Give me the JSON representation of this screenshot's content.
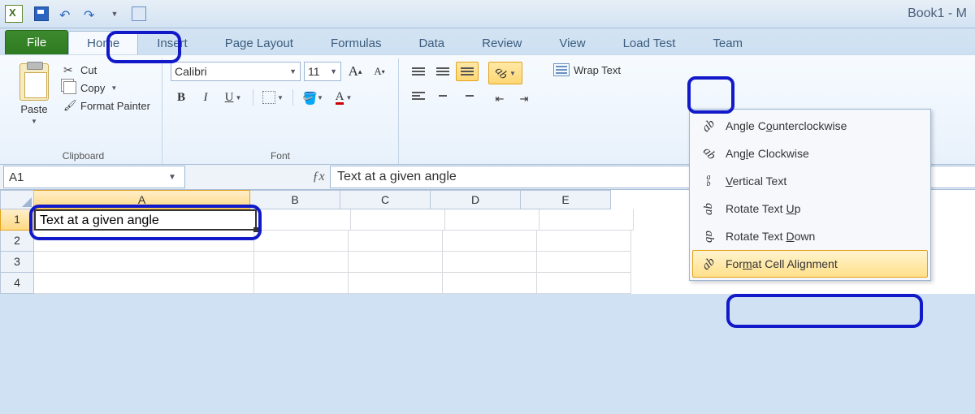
{
  "title": "Book1 - M",
  "tabs": [
    "File",
    "Home",
    "Insert",
    "Page Layout",
    "Formulas",
    "Data",
    "Review",
    "View",
    "Load Test",
    "Team"
  ],
  "active_tab": "Home",
  "clipboard": {
    "paste": "Paste",
    "cut": "Cut",
    "copy": "Copy",
    "format_painter": "Format Painter",
    "group": "Clipboard"
  },
  "font": {
    "name": "Calibri",
    "size": "11",
    "group": "Font",
    "bold": "B",
    "italic": "I",
    "underline": "U",
    "grow": "A",
    "shrink": "A"
  },
  "alignment": {
    "wrap": "Wrap Text"
  },
  "orientation_menu": [
    {
      "label": "Angle Counterclockwise",
      "accel": "o",
      "icon": "ccw"
    },
    {
      "label": "Angle Clockwise",
      "accel": "l",
      "icon": "cw"
    },
    {
      "label": "Vertical Text",
      "accel": "V",
      "icon": "vert"
    },
    {
      "label": "Rotate Text Up",
      "accel": "U",
      "icon": "up"
    },
    {
      "label": "Rotate Text Down",
      "accel": "D",
      "icon": "down"
    },
    {
      "label": "Format Cell Alignment",
      "accel": "m",
      "icon": "fmt"
    }
  ],
  "orientation_hover_index": 5,
  "namebox": "A1",
  "formula": "Text at a given angle",
  "columns": [
    "A",
    "B",
    "C",
    "D",
    "E"
  ],
  "rows": [
    "1",
    "2",
    "3",
    "4"
  ],
  "active_cell": {
    "row": 0,
    "col": 0,
    "value": "Text at a given angle"
  }
}
